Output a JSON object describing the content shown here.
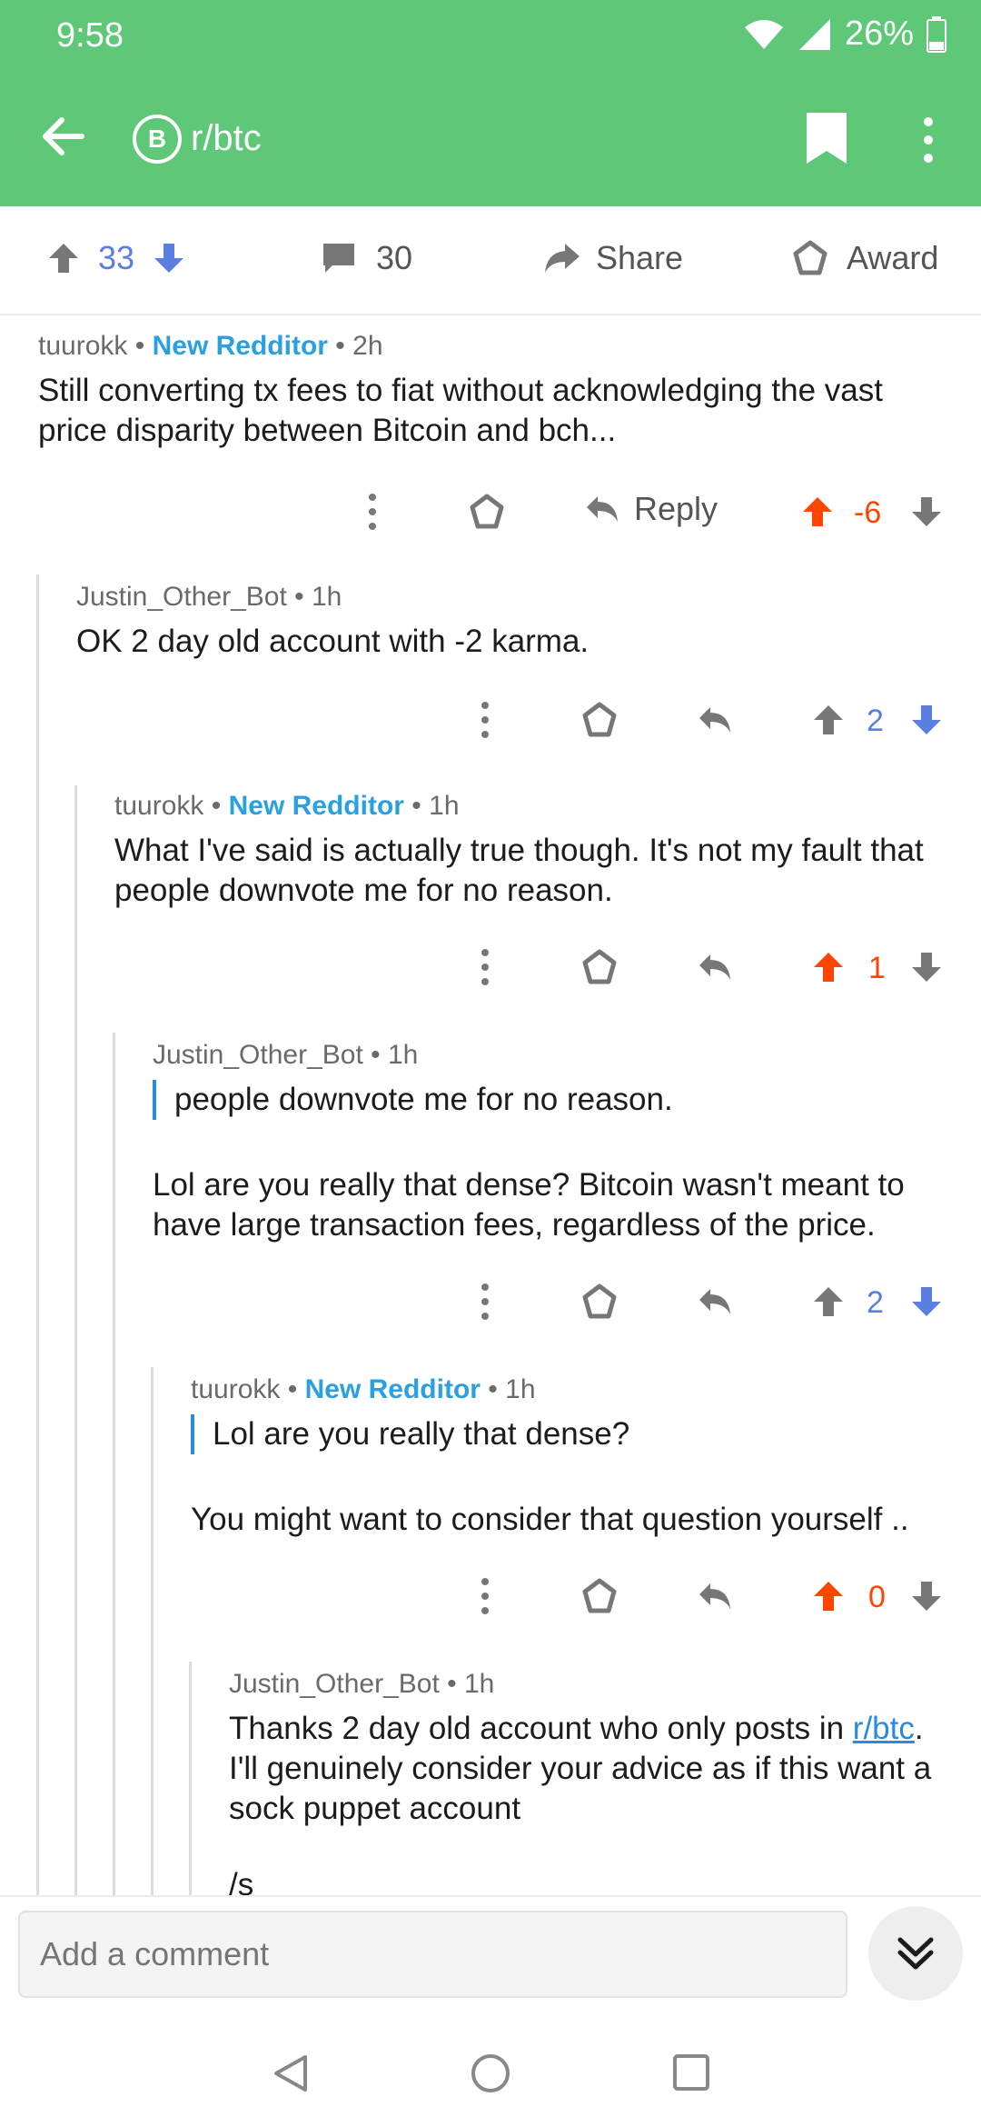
{
  "status": {
    "time": "9:58",
    "battery": "26%"
  },
  "toolbar": {
    "subreddit": "r/btc",
    "logo_glyph": "B"
  },
  "post_actions": {
    "score": "33",
    "comments": "30",
    "share": "Share",
    "award": "Award"
  },
  "comments": [
    {
      "author": "tuurokk",
      "flair": "New Redditor",
      "age": "2h",
      "body": "Still converting tx fees to fiat without acknowledging the vast price disparity between Bitcoin and bch...",
      "reply_label": "Reply",
      "score": "-6",
      "vote": "up"
    },
    {
      "author": "Justin_Other_Bot",
      "age": "1h",
      "body": "OK 2 day old account with -2 karma.",
      "score": "2",
      "vote": "down"
    },
    {
      "author": "tuurokk",
      "flair": "New Redditor",
      "age": "1h",
      "body": "What I've said is actually true though.  It's not my fault that people downvote me for no reason.",
      "score": "1",
      "vote": "up"
    },
    {
      "author": "Justin_Other_Bot",
      "age": "1h",
      "quote": "people downvote me for no reason.",
      "body": "Lol are you really that dense? Bitcoin wasn't meant to have large transaction fees, regardless of the price.",
      "score": "2",
      "vote": "down"
    },
    {
      "author": "tuurokk",
      "flair": "New Redditor",
      "age": "1h",
      "quote": "Lol are you really that dense?",
      "body": "You might want to consider that question yourself ..",
      "score": "0",
      "vote": "up"
    },
    {
      "author": "Justin_Other_Bot",
      "age": "1h",
      "body_before": "Thanks 2 day old account who only posts in ",
      "link": "r/btc",
      "body_after": ". I'll genuinely consider your advice as if this want a sock puppet account",
      "trailing": "/s"
    }
  ],
  "separator": "•",
  "bottom": {
    "placeholder": "Add a comment"
  },
  "colors": {
    "header": "#5ec878",
    "upvote": "#ff4500",
    "downvote": "#5b7fe0",
    "flair": "#2aa0e0"
  }
}
